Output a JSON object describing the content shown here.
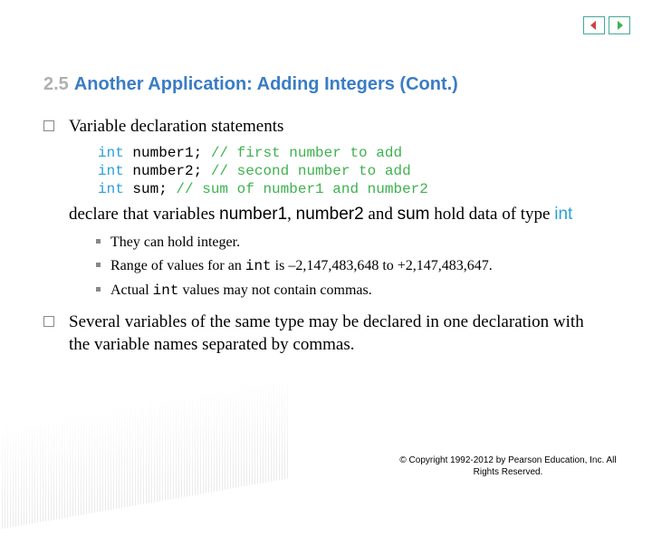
{
  "nav": {
    "prev": "prev-arrow",
    "next": "next-arrow"
  },
  "title": {
    "number": "2.5",
    "text": "Another Application: Adding Integers (Cont.)"
  },
  "bullet1": {
    "lead": "Variable declaration statements",
    "code": {
      "l1a": "int",
      "l1b": " number1; ",
      "l1c": "// first number to add",
      "l2a": "int",
      "l2b": " number2; ",
      "l2c": "// second number to add",
      "l3a": "int",
      "l3b": " sum; ",
      "l3c": "// sum of number1 and number2"
    },
    "tail1": "declare that variables ",
    "v1": "number1",
    "comma1": ", ",
    "v2": "number2",
    "and": " and ",
    "v3": "sum",
    "tail2": " hold data of type ",
    "intkw": "int",
    "sub1": "They can hold integer.",
    "sub2a": "Range of values for an ",
    "sub2b": "int",
    "sub2c": " is –2,147,483,648 to +2,147,483,647.",
    "sub3a": "Actual ",
    "sub3b": "int",
    "sub3c": " values may not contain commas."
  },
  "bullet2": "Several variables of the same type may be declared in one declaration with the variable names separated by commas.",
  "copyright": "© Copyright 1992-2012 by Pearson Education, Inc. All Rights Reserved."
}
